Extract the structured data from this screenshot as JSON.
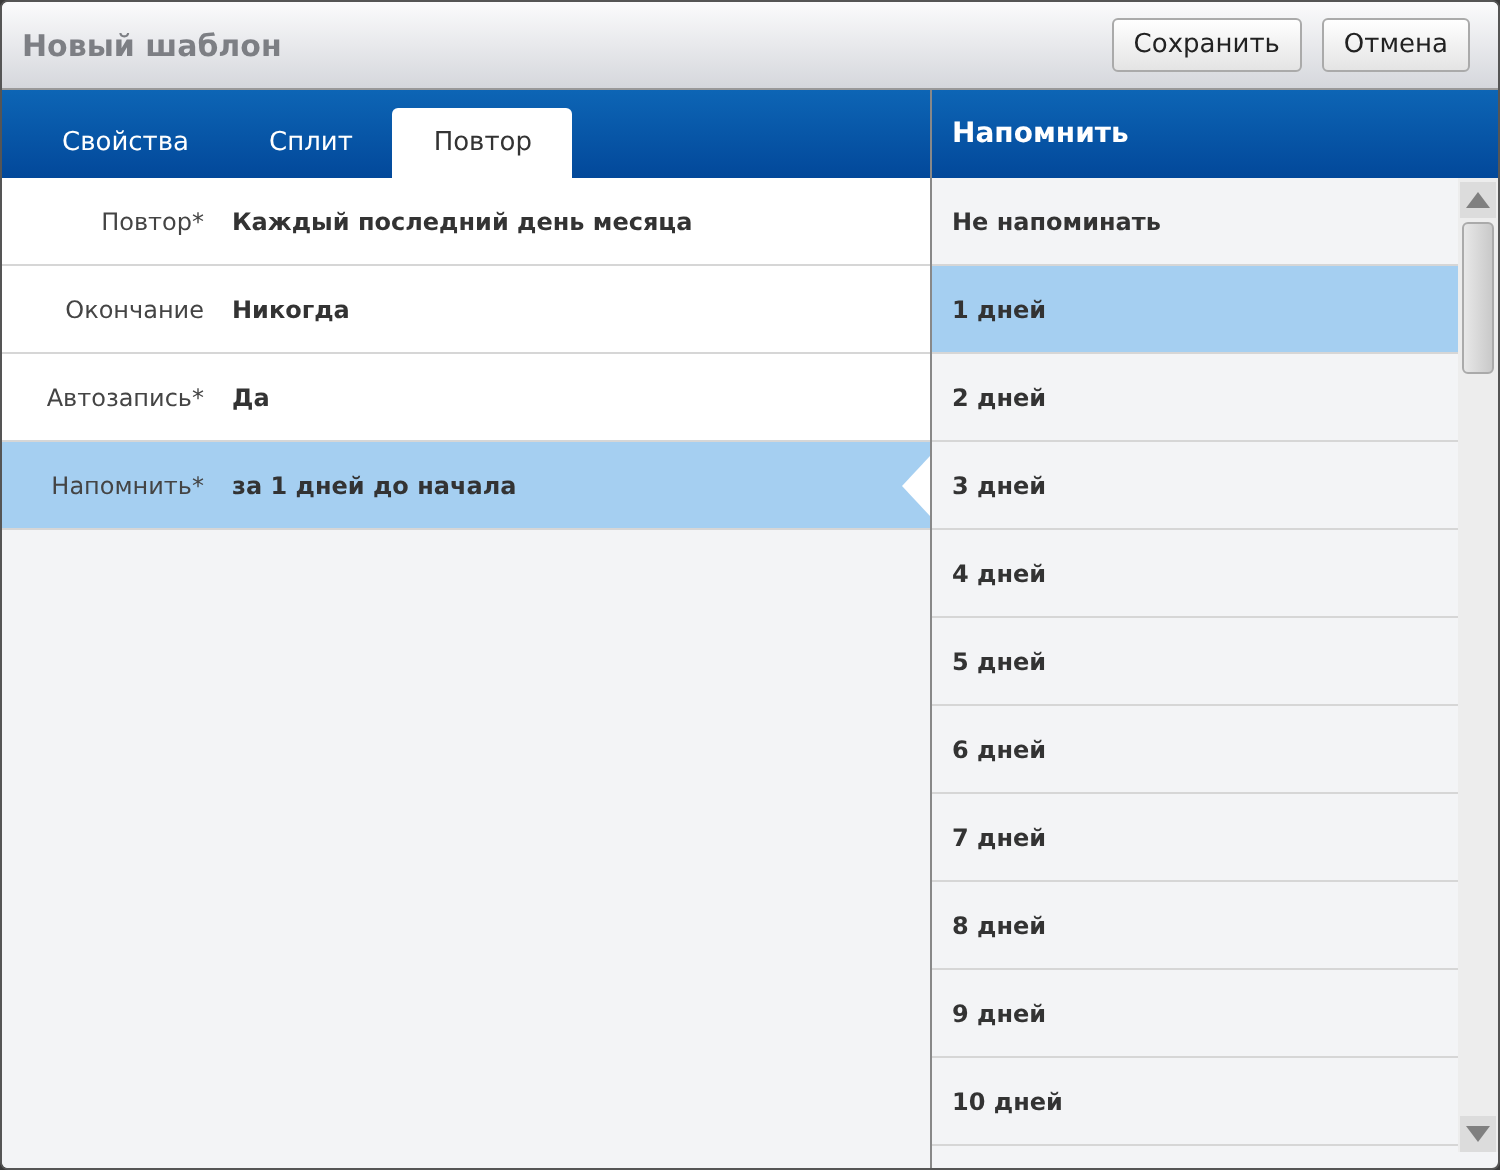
{
  "window": {
    "title": "Новый шаблон"
  },
  "buttons": [
    "Сохранить",
    "Отмена"
  ],
  "tabs": [
    {
      "label": "Свойства",
      "selected": false
    },
    {
      "label": "Сплит",
      "selected": false
    },
    {
      "label": "Повтор",
      "selected": true
    }
  ],
  "fields": [
    {
      "label": "Повтор*",
      "value": "Каждый последний день месяца",
      "selected": false
    },
    {
      "label": "Окончание",
      "value": "Никогда",
      "selected": false
    },
    {
      "label": "Автозапись*",
      "value": "Да",
      "selected": false
    },
    {
      "label": "Напомнить*",
      "value": "за 1 дней до начала",
      "selected": true
    }
  ],
  "reminder_panel": {
    "title": "Напомнить",
    "options": [
      {
        "label": "Не напоминать",
        "selected": false
      },
      {
        "label": "1 дней",
        "selected": true
      },
      {
        "label": "2 дней",
        "selected": false
      },
      {
        "label": "3 дней",
        "selected": false
      },
      {
        "label": "4 дней",
        "selected": false
      },
      {
        "label": "5 дней",
        "selected": false
      },
      {
        "label": "6 дней",
        "selected": false
      },
      {
        "label": "7 дней",
        "selected": false
      },
      {
        "label": "8 дней",
        "selected": false
      },
      {
        "label": "9 дней",
        "selected": false
      },
      {
        "label": "10 дней",
        "selected": false
      }
    ]
  }
}
